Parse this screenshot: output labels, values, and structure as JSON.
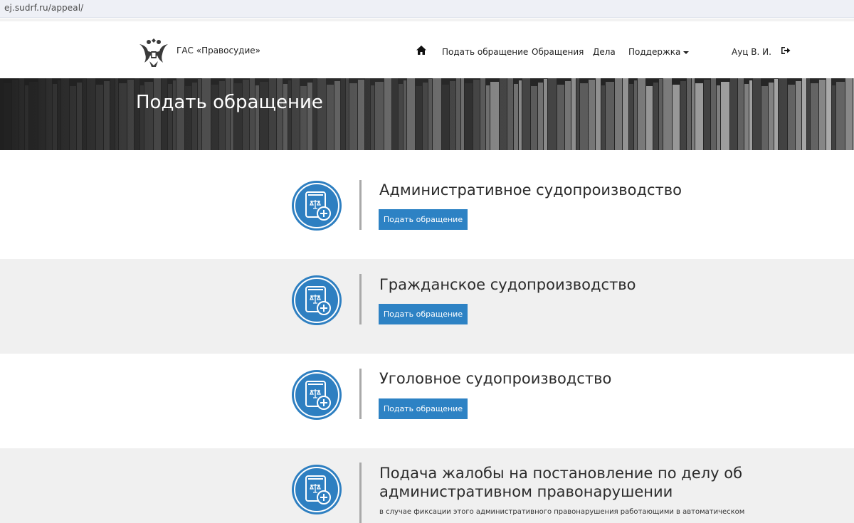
{
  "browser": {
    "url": "ej.sudrf.ru/appeal/"
  },
  "header": {
    "brand": "ГАС «Правосудие»",
    "nav": {
      "home_icon": "home-icon",
      "submit": "Подать обращение",
      "appeals": "Обращения",
      "cases": "Дела",
      "support": "Поддержка"
    },
    "user": "Ауц В. И.",
    "logout_icon": "logout-icon"
  },
  "banner": {
    "title": "Подать обращение"
  },
  "sections": [
    {
      "title": "Административное судопроизводство",
      "button": "Подать обращение"
    },
    {
      "title": "Гражданское судопроизводство",
      "button": "Подать обращение"
    },
    {
      "title": "Уголовное судопроизводство",
      "button": "Подать обращение"
    },
    {
      "title_line1": "Подача жалобы на постановление по делу об",
      "title_line2": "административном правонарушении",
      "note": "в случае фиксации этого административного правонарушения работающими в автоматическом"
    }
  ],
  "colors": {
    "accent": "#2d82c4",
    "icon_blue": "#2e7fc1",
    "grey_section": "#f0f0f0"
  }
}
